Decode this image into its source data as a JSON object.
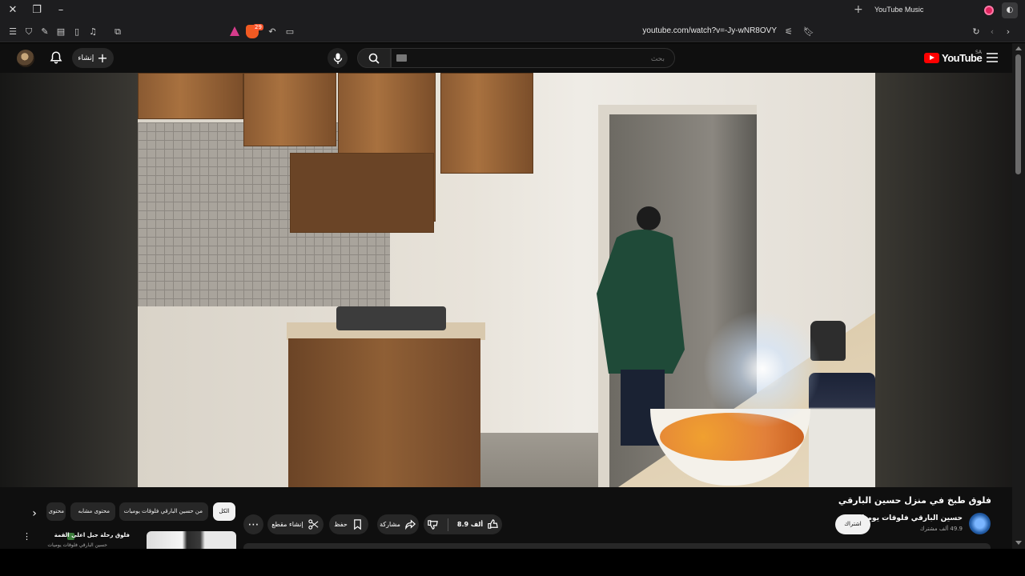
{
  "browser": {
    "tab_title": "YouTube Music",
    "url": "youtube.com/watch?v=-Jy-wNR8OVY",
    "extension_badge": "29"
  },
  "masthead": {
    "create_label": "إنشاء",
    "search_placeholder": "بحث",
    "logo_text": "YouTube",
    "region": "SA"
  },
  "video": {
    "title": "فلوق طبخ في منزل حسين البارقي",
    "channel_name": "حسين البارقي فلوقات يوميات",
    "subscribers": "49.9 ألف مشترك",
    "subscribe_label": "اشتراك",
    "likes": "8.9 ألف",
    "share_label": "مشاركة",
    "save_label": "حفظ",
    "clip_label": "إنشاء مقطع"
  },
  "chips": {
    "all": "الكل",
    "from_channel": "من حسين البارقي فلوقات يوميات",
    "related": "محتوى مشابه",
    "more": "محتوى"
  },
  "recommendation": {
    "title": "فلوق رحلة جبل اعلى القمة",
    "subtitle": "حسين البارقي فلوقات يوميات"
  },
  "colors": {
    "yt_red": "#ff0000",
    "page_bg": "#0f0f0f",
    "chip_bg": "#272727"
  }
}
